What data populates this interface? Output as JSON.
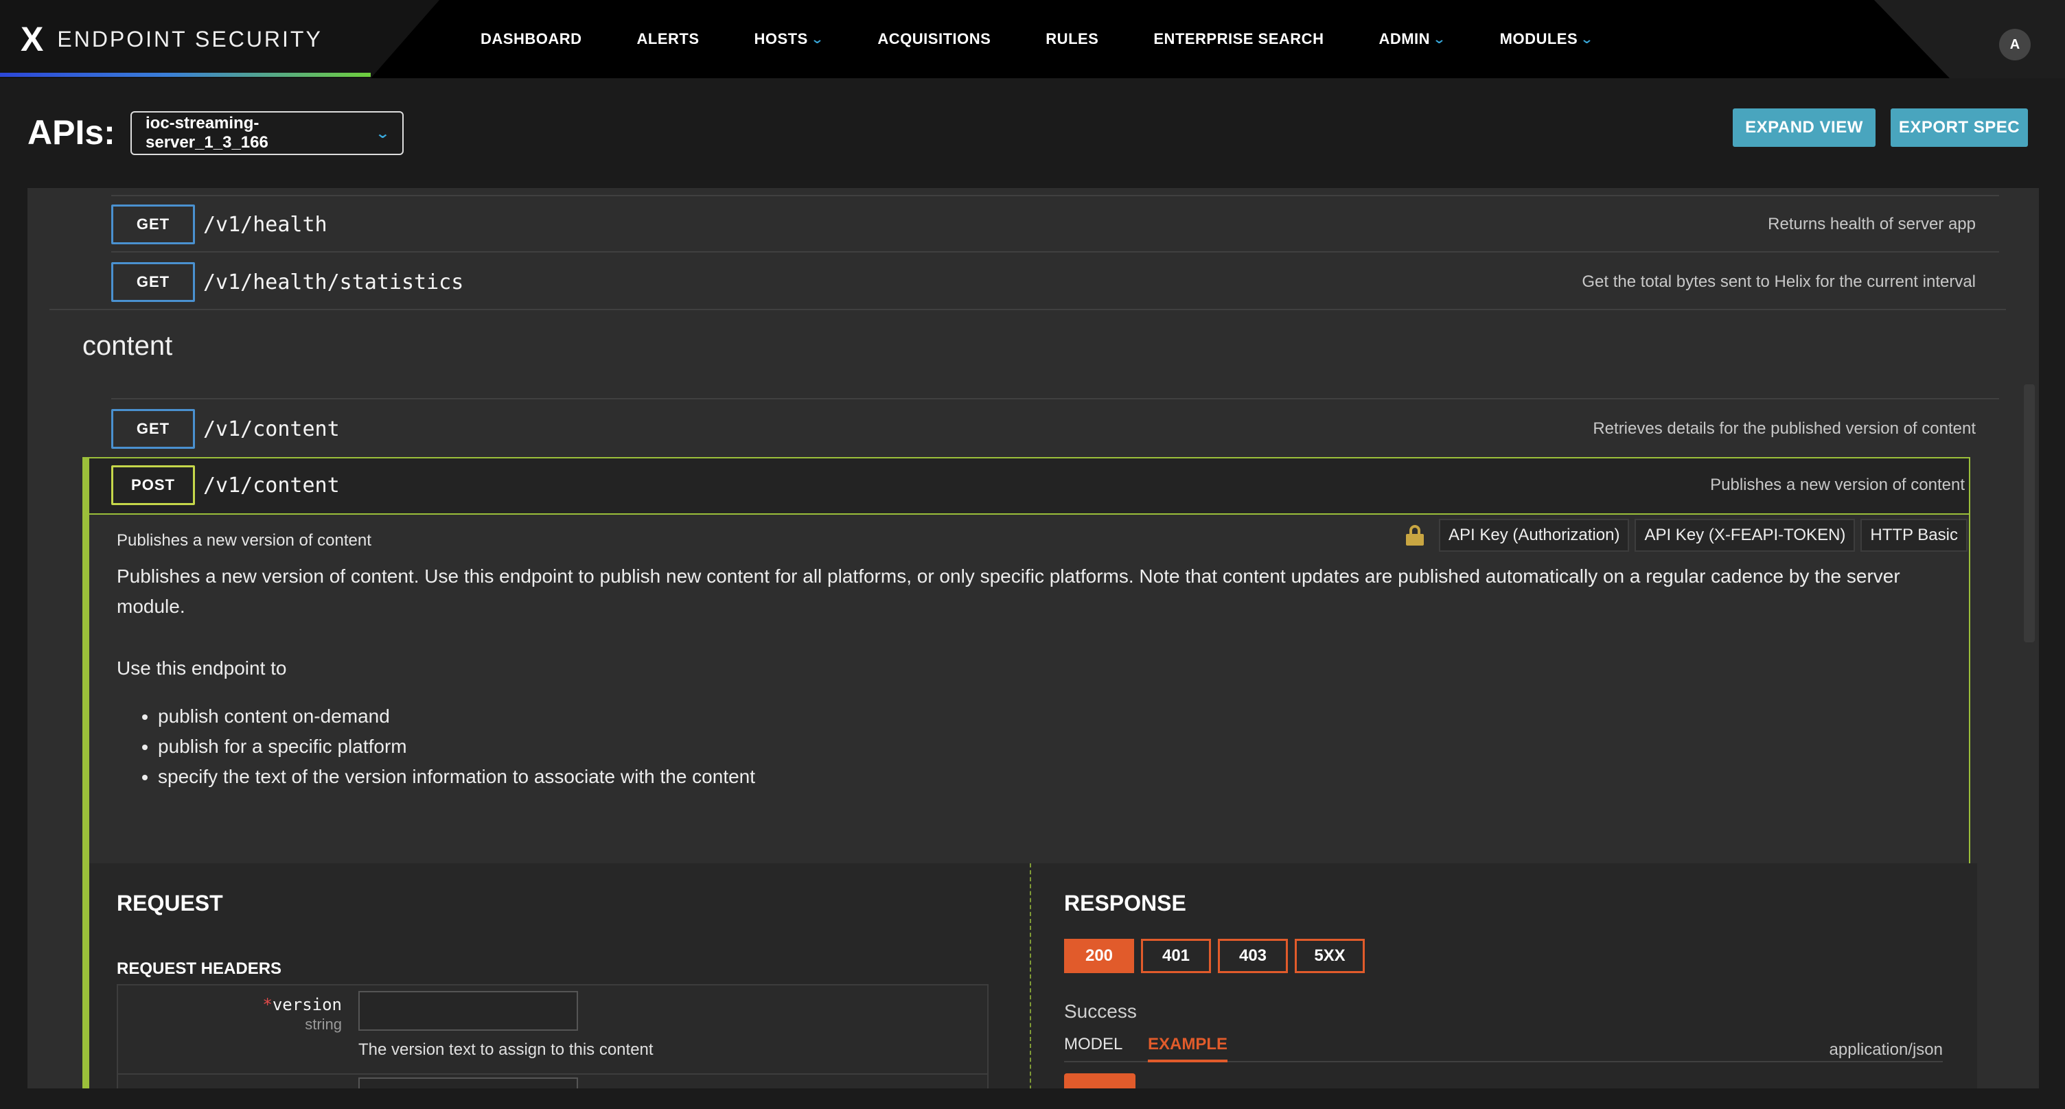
{
  "nav": {
    "brand": "ENDPOINT SECURITY",
    "brand_mark": "X",
    "items": [
      {
        "label": "DASHBOARD",
        "dropdown": false
      },
      {
        "label": "ALERTS",
        "dropdown": false
      },
      {
        "label": "HOSTS",
        "dropdown": true
      },
      {
        "label": "ACQUISITIONS",
        "dropdown": false
      },
      {
        "label": "RULES",
        "dropdown": false
      },
      {
        "label": "ENTERPRISE SEARCH",
        "dropdown": false
      },
      {
        "label": "ADMIN",
        "dropdown": true
      },
      {
        "label": "MODULES",
        "dropdown": true
      }
    ],
    "avatar": "A"
  },
  "toolbar": {
    "title": "APIs:",
    "selected_api": "ioc-streaming-server_1_3_166",
    "expand_label": "EXPAND VIEW",
    "export_label": "EXPORT SPEC"
  },
  "operations": [
    {
      "method": "GET",
      "path": "/v1/health",
      "summary": "Returns health of server app"
    },
    {
      "method": "GET",
      "path": "/v1/health/statistics",
      "summary": "Get the total bytes sent to Helix for the current interval"
    }
  ],
  "content_section": {
    "title": "content",
    "get_op": {
      "method": "GET",
      "path": "/v1/content",
      "summary": "Retrieves details for the published version of content"
    },
    "post_op": {
      "method": "POST",
      "path": "/v1/content",
      "summary": "Publishes a new version of content",
      "auth": [
        "API Key (Authorization)",
        "API Key (X-FEAPI-TOKEN)",
        "HTTP Basic"
      ],
      "description_short": "Publishes a new version of content",
      "description_long": "Publishes a new version of content. Use this endpoint to publish new content for all platforms, or only specific platforms. Note that content updates are published automatically on a regular cadence by the server module.",
      "use_title": "Use this endpoint to",
      "use_items": [
        "publish content on-demand",
        "publish for a specific platform",
        "specify the text of the version information to associate with the content"
      ]
    }
  },
  "request": {
    "title": "REQUEST",
    "headers_title": "REQUEST HEADERS",
    "params": [
      {
        "required_mark": "*",
        "name": "version",
        "type": "string",
        "description": "The version text to assign to this content",
        "value": ""
      }
    ]
  },
  "response": {
    "title": "RESPONSE",
    "codes": [
      "200",
      "401",
      "403",
      "5XX"
    ],
    "active_code": "200",
    "status_text": "Success",
    "tabs": [
      "MODEL",
      "EXAMPLE"
    ],
    "active_tab": "EXAMPLE",
    "mime": "application/json"
  },
  "colors": {
    "get_border": "#4a91d0",
    "post_border": "#c5d74a",
    "accent_teal": "#49a5be",
    "response_orange": "#e15b2b",
    "nav_chevron": "#39a9dc"
  }
}
